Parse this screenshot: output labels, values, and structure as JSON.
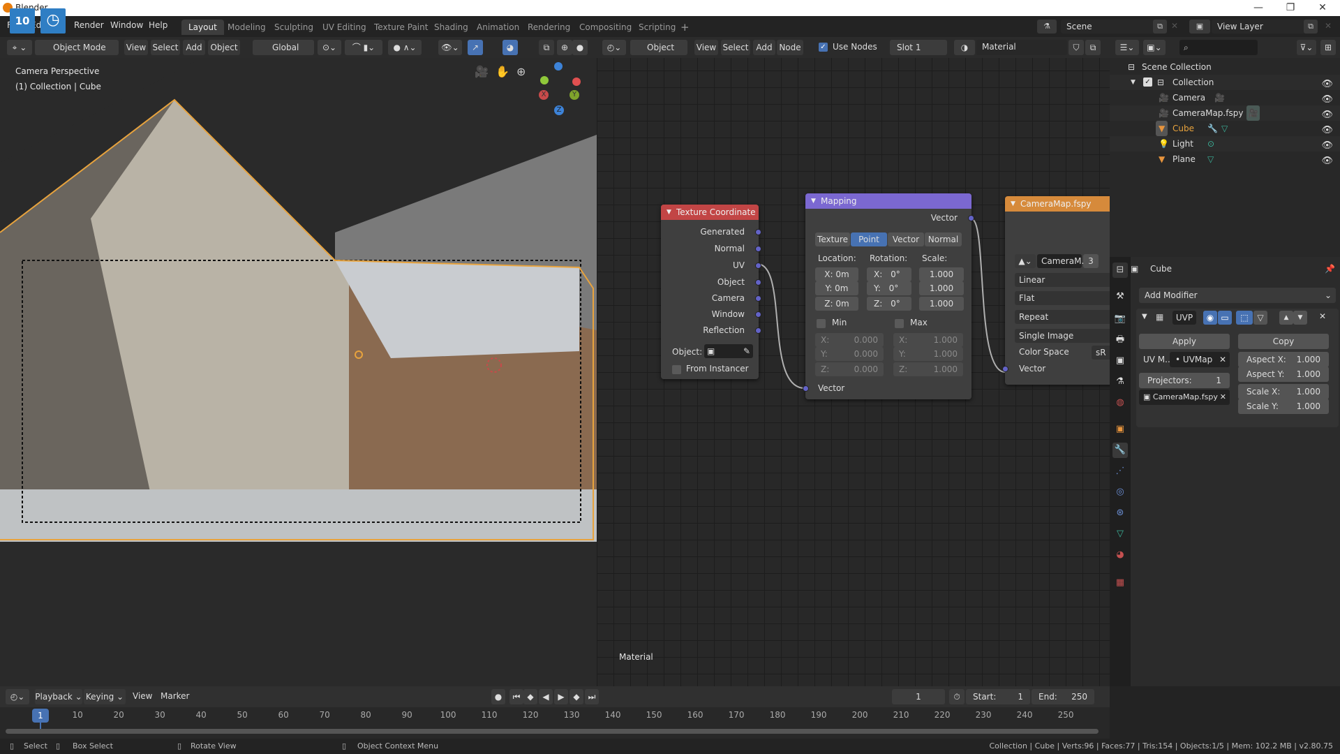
{
  "window": {
    "title": "Blender",
    "controls": {
      "minimize": "—",
      "maximize": "❐",
      "close": "✕"
    },
    "overlay_badges": [
      "10",
      "clock"
    ]
  },
  "menubar": {
    "menus": [
      "File",
      "Edit",
      "Render",
      "Window",
      "Help"
    ],
    "workspace_tabs": [
      "Layout",
      "Modeling",
      "Sculpting",
      "UV Editing",
      "Texture Paint",
      "Shading",
      "Animation",
      "Rendering",
      "Compositing",
      "Scripting"
    ],
    "active_tab": "Layout",
    "add_tab": "+",
    "scene": "Scene",
    "view_layer": "View Layer"
  },
  "viewport": {
    "header": {
      "mode": "Object Mode",
      "menus": [
        "View",
        "Select",
        "Add",
        "Object"
      ],
      "orientation": "Global"
    },
    "overlay_text": {
      "line1": "Camera Perspective",
      "line2": "(1) Collection | Cube"
    },
    "gizmo": {
      "x": "X",
      "y": "Y",
      "z": "Z"
    },
    "colors": {
      "x": "#c84a4a",
      "y": "#7fa32b",
      "z": "#3d83d8",
      "selection": "#e8a33d"
    }
  },
  "node_editor": {
    "header": {
      "type": "Object",
      "menus": [
        "View",
        "Select",
        "Add",
        "Node"
      ],
      "use_nodes_label": "Use Nodes",
      "use_nodes": true,
      "slot": "Slot 1",
      "material": "Material"
    },
    "tree_label": "Material",
    "texture_coordinate": {
      "title": "Texture Coordinate",
      "color": "#c24545",
      "outputs": [
        "Generated",
        "Normal",
        "UV",
        "Object",
        "Camera",
        "Window",
        "Reflection"
      ],
      "object_label": "Object:",
      "from_instancer": "From Instancer"
    },
    "mapping": {
      "title": "Mapping",
      "color": "#7b68d1",
      "output": "Vector",
      "types": [
        "Texture",
        "Point",
        "Vector",
        "Normal"
      ],
      "active_type": "Point",
      "location_label": "Location:",
      "rotation_label": "Rotation:",
      "scale_label": "Scale:",
      "location": [
        "X: 0m",
        "Y: 0m",
        "Z: 0m"
      ],
      "rotation_axes": [
        "X:",
        "Y:",
        "Z:"
      ],
      "rotation": [
        "0°",
        "0°",
        "0°"
      ],
      "scale": [
        "1.000",
        "1.000",
        "1.000"
      ],
      "min_label": "Min",
      "max_label": "Max",
      "min_axes": [
        "X:",
        "Y:",
        "Z:"
      ],
      "min": [
        "0.000",
        "0.000",
        "0.000"
      ],
      "max": [
        "1.000",
        "1.000",
        "1.000"
      ],
      "input": "Vector"
    },
    "image_texture": {
      "title": "CameraMap.fspy",
      "color": "#d68a3b",
      "image": "CameraM..",
      "users": "3",
      "interpolation": "Linear",
      "projection": "Flat",
      "extension": "Repeat",
      "source": "Single Image",
      "color_space_label": "Color Space",
      "color_space": "sR",
      "input": "Vector"
    }
  },
  "outliner": {
    "root": "Scene Collection",
    "collection": "Collection",
    "items": [
      {
        "name": "Camera",
        "type": "camera"
      },
      {
        "name": "CameraMap.fspy",
        "type": "camera"
      },
      {
        "name": "Cube",
        "type": "mesh",
        "active": true
      },
      {
        "name": "Light",
        "type": "light"
      },
      {
        "name": "Plane",
        "type": "mesh"
      }
    ]
  },
  "properties": {
    "object": "Cube",
    "add_modifier": "Add Modifier",
    "modifier_name": "UVP",
    "apply": "Apply",
    "copy": "Copy",
    "uv_map_label": "UV M..",
    "uv_map": "UVMap",
    "projectors_label": "Projectors:",
    "projectors": "1",
    "projector_object": "CameraMap.fspy",
    "aspect_x_label": "Aspect X:",
    "aspect_x": "1.000",
    "aspect_y_label": "Aspect Y:",
    "aspect_y": "1.000",
    "scale_x_label": "Scale X:",
    "scale_x": "1.000",
    "scale_y_label": "Scale Y:",
    "scale_y": "1.000"
  },
  "timeline": {
    "menus": [
      "Playback",
      "Keying",
      "View",
      "Marker"
    ],
    "current_frame": "1",
    "start_label": "Start:",
    "start": "1",
    "end_label": "End:",
    "end": "250",
    "ticks": [
      "10",
      "20",
      "30",
      "40",
      "50",
      "60",
      "70",
      "80",
      "90",
      "100",
      "110",
      "120",
      "130",
      "140",
      "150",
      "160",
      "170",
      "180",
      "190",
      "200",
      "210",
      "220",
      "230",
      "240",
      "250"
    ]
  },
  "statusbar": {
    "select": "Select",
    "box_select": "Box Select",
    "rotate_view": "Rotate View",
    "context_menu": "Object Context Menu",
    "stats": "Collection | Cube | Verts:96 | Faces:77 | Tris:154 | Objects:1/5 | Mem: 102.2 MB | v2.80.75"
  }
}
